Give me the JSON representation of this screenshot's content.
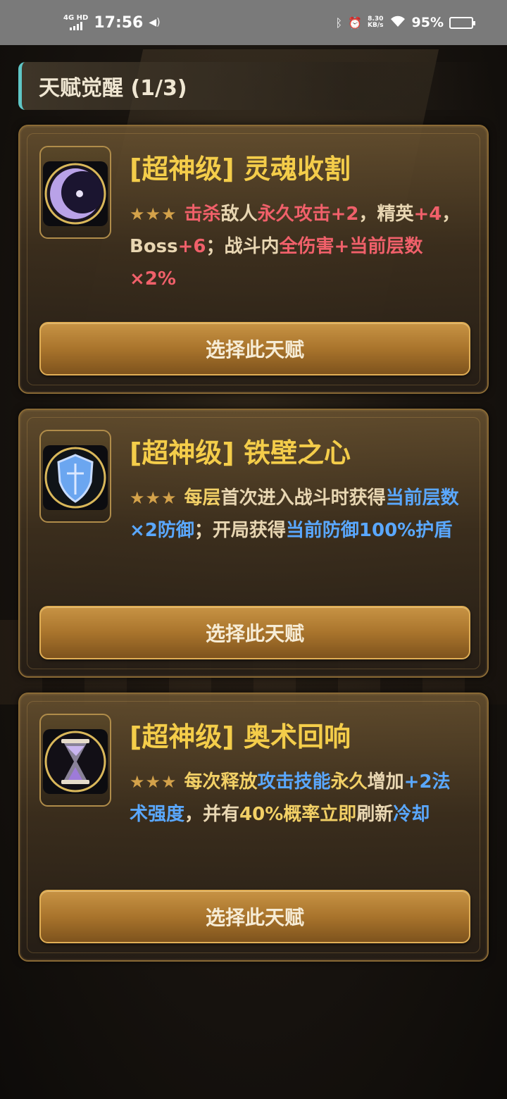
{
  "status_bar": {
    "network": "4G HD",
    "time": "17:56",
    "speed_value": "8.30",
    "speed_unit": "KB/s",
    "battery_pct": "95%",
    "battery_level": 0.95
  },
  "header": {
    "title": "天赋觉醒 (1/3)"
  },
  "accent_colors": {
    "header_bar": "#5fc6c6",
    "title_gold": "#f4cd4a",
    "highlight_red": "#f0606a",
    "highlight_blue": "#5aa8ff"
  },
  "talents": [
    {
      "title": "[超神级] 灵魂收割",
      "icon": "crescent-moon-icon",
      "stars": "★★★",
      "desc": [
        {
          "t": "击杀",
          "c": "red"
        },
        {
          "t": "敌人",
          "c": "normal"
        },
        {
          "t": "永久攻击+2",
          "c": "red"
        },
        {
          "t": "，精英",
          "c": "normal"
        },
        {
          "t": "+4",
          "c": "red"
        },
        {
          "t": "，Boss",
          "c": "normal"
        },
        {
          "t": "+6",
          "c": "red"
        },
        {
          "t": "；战斗内",
          "c": "normal"
        },
        {
          "t": "全伤害+当前层数×2%",
          "c": "red"
        }
      ],
      "button_label": "选择此天赋"
    },
    {
      "title": "[超神级] 铁壁之心",
      "icon": "shield-icon",
      "stars": "★★★",
      "desc": [
        {
          "t": "每层",
          "c": "gold"
        },
        {
          "t": "首次进入战斗时获得",
          "c": "normal"
        },
        {
          "t": "当前层数×2防御",
          "c": "blue"
        },
        {
          "t": "；开局获得",
          "c": "normal"
        },
        {
          "t": "当前防御100%护盾",
          "c": "blue"
        }
      ],
      "button_label": "选择此天赋"
    },
    {
      "title": "[超神级] 奥术回响",
      "icon": "hourglass-icon",
      "stars": "★★★",
      "desc": [
        {
          "t": "每次释放",
          "c": "gold"
        },
        {
          "t": "攻击技能",
          "c": "blue"
        },
        {
          "t": "永久",
          "c": "gold"
        },
        {
          "t": "增加",
          "c": "normal"
        },
        {
          "t": "+2法术强度",
          "c": "blue"
        },
        {
          "t": "，并有",
          "c": "normal"
        },
        {
          "t": "40%概率立即",
          "c": "gold"
        },
        {
          "t": "刷新",
          "c": "normal"
        },
        {
          "t": "冷却",
          "c": "blue"
        }
      ],
      "button_label": "选择此天赋"
    }
  ]
}
